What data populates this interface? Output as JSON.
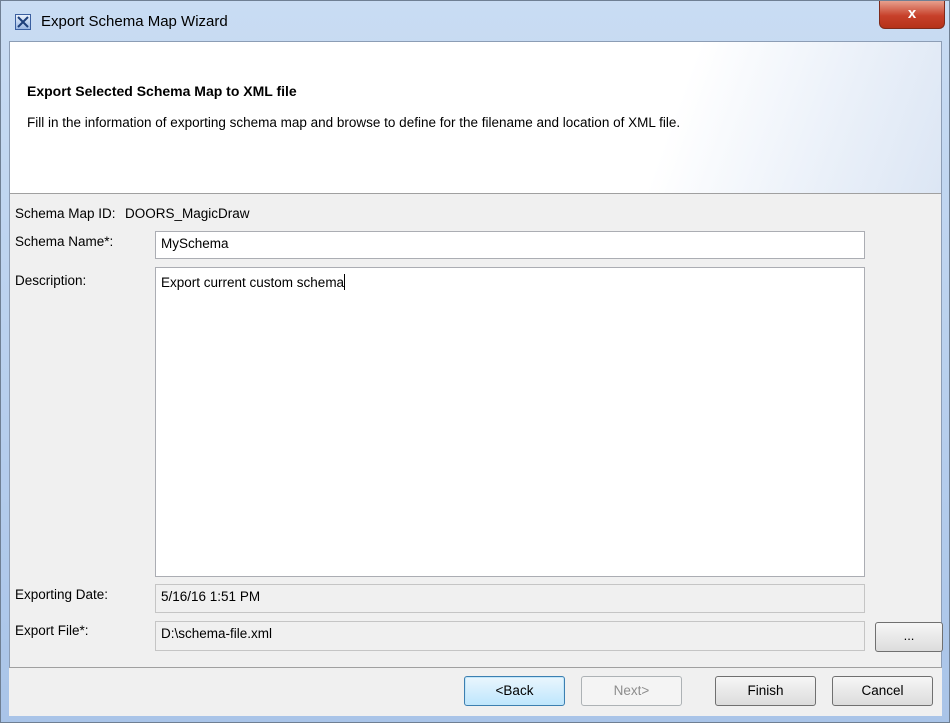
{
  "window": {
    "title": "Export Schema Map Wizard",
    "close_label": "x"
  },
  "header": {
    "title": "Export Selected Schema Map to XML file",
    "description": "Fill in the information of exporting schema map and browse to define for the filename and location of XML file."
  },
  "form": {
    "schema_map_id_label": "Schema Map ID:",
    "schema_map_id_value": "DOORS_MagicDraw",
    "schema_name_label": "Schema Name*:",
    "schema_name_value": "MySchema",
    "description_label": "Description:",
    "description_value": "Export current custom schema",
    "exporting_date_label": "Exporting Date:",
    "exporting_date_value": "5/16/16 1:51 PM",
    "export_file_label": "Export File*:",
    "export_file_value": "D:\\schema-file.xml",
    "browse_label": "..."
  },
  "buttons": {
    "back": "<Back",
    "next": "Next>",
    "finish": "Finish",
    "cancel": "Cancel"
  }
}
